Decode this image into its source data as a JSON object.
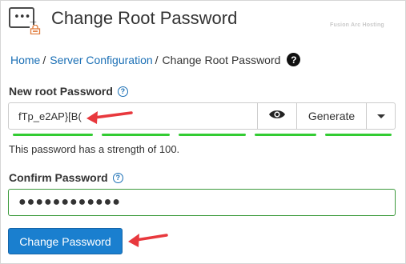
{
  "header": {
    "title": "Change Root Password",
    "watermark": "Fusion Arc Hosting",
    "icon": "password-terminal-lock-icon"
  },
  "breadcrumb": {
    "home": "Home",
    "separator": "/",
    "section": "Server Configuration",
    "current": "Change Root Password",
    "help_icon": "?"
  },
  "new_password": {
    "label": "New root Password",
    "info_icon": "?",
    "value": "fTp_e2AP}[B(",
    "show_icon": "eye-icon",
    "generate_label": "Generate",
    "strength_text": "This password has a strength of 100.",
    "strength_percent": 100
  },
  "confirm_password": {
    "label": "Confirm Password",
    "info_icon": "?",
    "value": "●●●●●●●●●●●●"
  },
  "submit_label": "Change Password",
  "colors": {
    "link": "#1a6fb5",
    "strength": "#33cc33",
    "primary_button": "#1a7fcf",
    "annotation_arrow": "#e8383d",
    "confirm_border": "#3c9a3c"
  }
}
